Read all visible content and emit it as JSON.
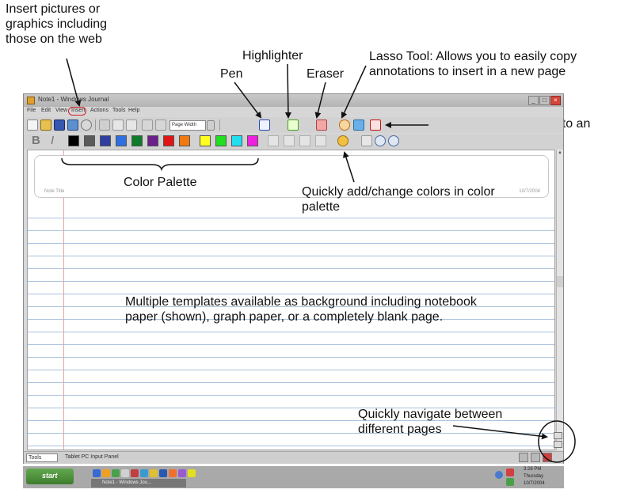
{
  "annotations": {
    "insert_pictures": "Insert pictures or graphics including those on the web",
    "pen": "Pen",
    "highlighter": "Highlighter",
    "eraser": "Eraser",
    "lasso": "Lasso Tool: Allows you to easily copy annotations to insert in a new page",
    "flag": "Flag: Insert a flag next to an important point",
    "color_palette": "Color Palette",
    "add_colors": "Quickly add/change colors in color palette",
    "templates": "Multiple templates available as background including notebook paper (shown), graph paper, or a completely blank page.",
    "navigate": "Quickly navigate between different pages"
  },
  "window": {
    "title": "Note1 - Windows Journal",
    "menu": [
      "File",
      "Edit",
      "View",
      "Insert",
      "Actions",
      "Tools",
      "Help"
    ],
    "page_width_select": "Page Width",
    "note_title_placeholder": "Note Title",
    "note_date": "10/7/2004",
    "status_tools": "Tools",
    "status_panel": "Tablet PC Input Panel"
  },
  "palette": {
    "colors": [
      "#000000",
      "#5a5a5a",
      "#2f3fa0",
      "#2f6fe0",
      "#0f7a2a",
      "#6a1f8a",
      "#e01414",
      "#f07a10",
      "#ffff20",
      "#20e020",
      "#20e0f0",
      "#f020e0"
    ]
  },
  "taskbar": {
    "start": "start",
    "task": "Note1 - Windows Jou...",
    "time": "3:28 PM",
    "day": "Thursday",
    "date": "10/7/2004"
  }
}
